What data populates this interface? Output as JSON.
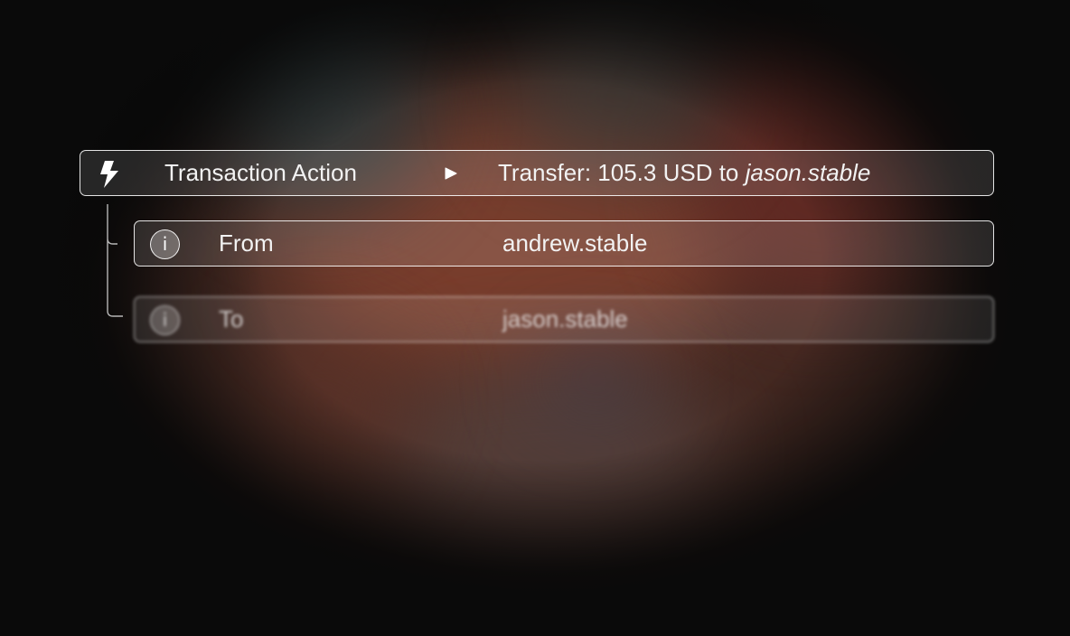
{
  "action_row": {
    "icon": "lightning-bolt-icon",
    "label": "Transaction Action",
    "expand_icon": "play-triangle-icon",
    "value_prefix": "Transfer: 105.3 USD to ",
    "value_recipient": "jason.stable"
  },
  "details": [
    {
      "icon": "info-icon",
      "label": "From",
      "value": "andrew.stable"
    },
    {
      "icon": "info-icon",
      "label": "To",
      "value": "jason.stable"
    }
  ],
  "colors": {
    "row_border": "#ffffff",
    "background": "#0a0a0a",
    "text": "#f2f2f2"
  }
}
